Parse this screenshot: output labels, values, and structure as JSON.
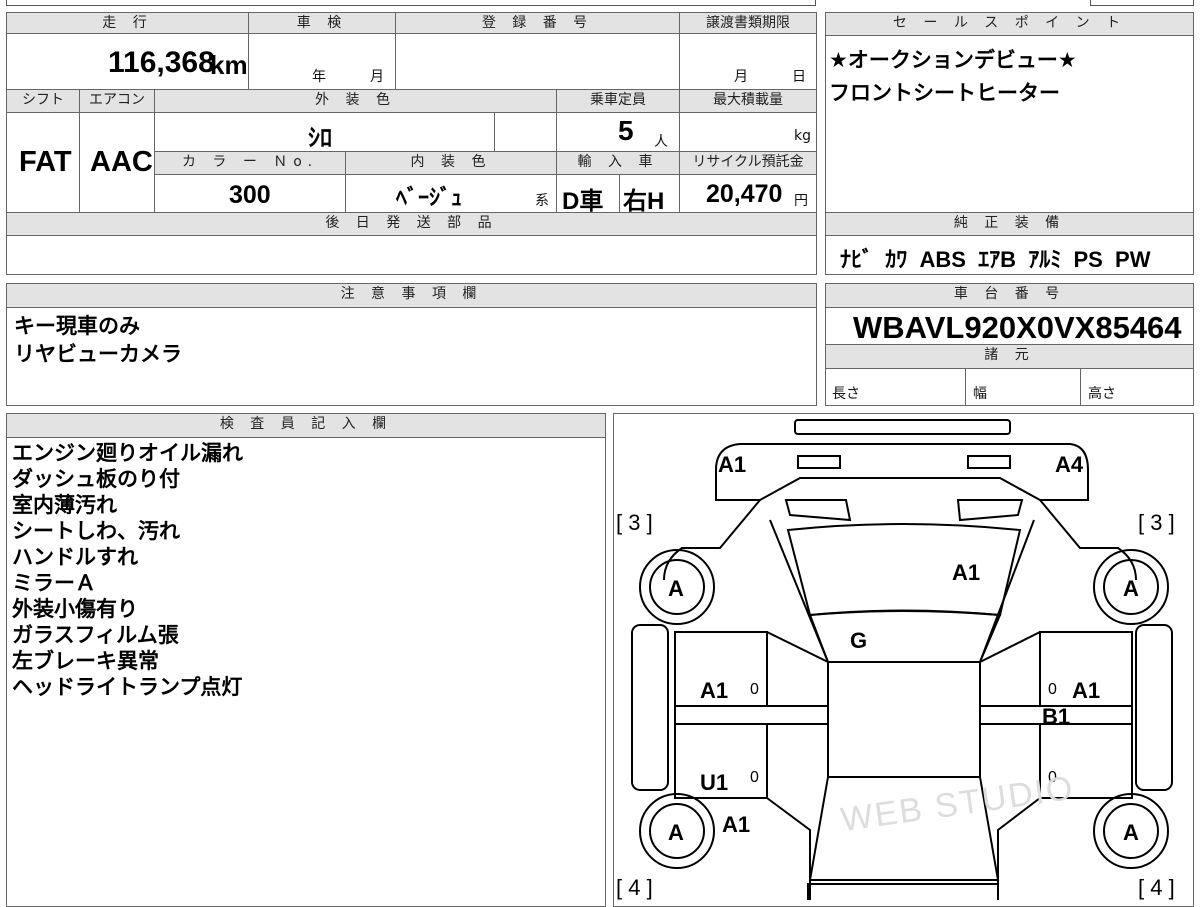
{
  "mileage": {
    "label": "走 行",
    "value": "116,368",
    "unit": "km"
  },
  "shaken": {
    "label": "車 検",
    "year_unit": "年",
    "month_unit": "月"
  },
  "registration": {
    "label": "登 録 番 号"
  },
  "transfer_deadline": {
    "label": "譲渡書類期限",
    "month_unit": "月",
    "day_unit": "日"
  },
  "shift": {
    "label": "シフト",
    "value": "FAT"
  },
  "aircon": {
    "label": "エアコン",
    "value": "AAC"
  },
  "exterior_color": {
    "label": "外 装 色",
    "value": "ｼﾛ"
  },
  "capacity": {
    "label": "乗車定員",
    "value": "5",
    "unit": "人"
  },
  "max_load": {
    "label": "最大積載量",
    "unit": "kg"
  },
  "color_no": {
    "label": "カ ラ ー Ｎo.",
    "value": "300"
  },
  "interior_color": {
    "label": "内 装 色",
    "value": "ﾍﾞｰｼﾞｭ",
    "suffix": "系"
  },
  "import": {
    "label": "輸 入 車",
    "type": "D車",
    "steering": "右H"
  },
  "recycle": {
    "label": "リサイクル預託金",
    "value": "20,470",
    "unit": "円"
  },
  "later_parts": {
    "label": "後 日 発 送 部 品"
  },
  "sales_point": {
    "label": "セ ー ル ス ポ イ ン ト",
    "lines": [
      "★オークションデビュー★",
      "フロントシートヒーター"
    ]
  },
  "equipment": {
    "label": "純 正 装 備",
    "items": "ﾅﾋﾞ  ｶﾜ  ABS  ｴｱB  ｱﾙﾐ  PS  PW"
  },
  "caution": {
    "label": "注 意 事 項 欄",
    "lines": [
      "キー現車のみ",
      "リヤビューカメラ"
    ]
  },
  "chassis": {
    "label": "車 台 番 号",
    "value": "WBAVL920X0VX85464"
  },
  "specs": {
    "label": "諸 元",
    "length": "長さ",
    "width": "幅",
    "height": "高さ"
  },
  "inspector": {
    "label": "検 査 員 記 入 欄",
    "lines": [
      "エンジン廻りオイル漏れ",
      "ダッシュ板のり付",
      "室内薄汚れ",
      "シートしわ、汚れ",
      "ハンドルすれ",
      "ミラーＡ",
      "外装小傷有り",
      "ガラスフィルム張",
      "左ブレーキ異常",
      "ヘッドライトランプ点灯"
    ]
  },
  "diagram": {
    "marks": {
      "front_left": "A1",
      "front_right": "A4",
      "windshield": "A1",
      "roof": "G",
      "left_front_door": "A1",
      "right_front_door": "A1",
      "right_door_extra": "B1",
      "left_rear_door": "U1",
      "left_rear_fender": "A1",
      "tire_fl": "A",
      "tire_fr": "A",
      "tire_rl": "A",
      "tire_rr": "A",
      "tread_front_left": "[ 3 ]",
      "tread_front_right": "[ 3 ]",
      "tread_rear_left": "[ 4 ]",
      "tread_rear_right": "[ 4 ]",
      "zero": "0"
    }
  },
  "watermark": "WEB STUDIO"
}
